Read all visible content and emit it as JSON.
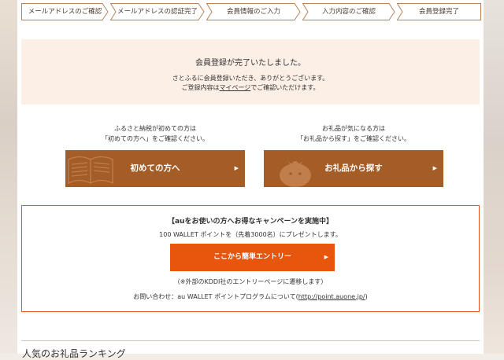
{
  "steps": [
    {
      "label": "メールアドレスのご確認"
    },
    {
      "label": "メールアドレスの認証完了"
    },
    {
      "label": "会員情報のご入力"
    },
    {
      "label": "入力内容のご確認"
    },
    {
      "label": "会員登録完了"
    }
  ],
  "completion": {
    "title": "会員登録が完了いたしました。",
    "line1": "さとふるに会員登録いただき、ありがとうございます。",
    "line2_prefix": "ご登録内容は",
    "line2_link": "マイページ",
    "line2_suffix": "でご確認いただけます。"
  },
  "first_time": {
    "note1": "ふるさと納税が初めての方は",
    "note2": "「初めての方へ」をご確認ください。",
    "button": "初めての方へ",
    "arrow": "▶"
  },
  "gifts": {
    "note1": "お礼品が気になる方は",
    "note2": "「お礼品から探す」をご確認ください。",
    "button": "お礼品から探す",
    "arrow": "▶"
  },
  "campaign": {
    "title": "【auをお使いの方へお得なキャンペーンを実施中】",
    "subtitle": "100 WALLET ポイントを（先着3000名）にプレゼントします。",
    "button": "ここから簡単エントリー",
    "arrow": "▶",
    "note": "（※外部のKDDI社のエントリーページに遷移します）",
    "contact_prefix": "お問い合わせ：au WALLET ポイントプログラムについて(",
    "contact_link": "http://point.auone.jp/",
    "contact_suffix": ")"
  },
  "ranking": {
    "title": "人気のお礼品ランキング"
  },
  "colors": {
    "brown_button": "#a55d27",
    "orange_button": "#e8560e",
    "campaign_border": "#e4561a",
    "completion_bg": "#fbefe6",
    "step_border": "#b5815a"
  }
}
